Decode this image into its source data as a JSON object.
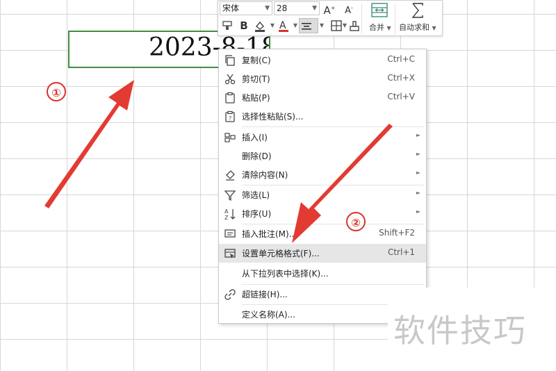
{
  "sheet": {
    "cell_value": "2023-8-18"
  },
  "toolbar": {
    "font_name": "宋体",
    "font_size": "28",
    "merge_label": "合并",
    "autosum_label": "自动求和",
    "underline_color": "#d9322b"
  },
  "menu": {
    "items": [
      {
        "label": "复制(C)",
        "shortcut": "Ctrl+C",
        "icon": "copy-icon"
      },
      {
        "label": "剪切(T)",
        "shortcut": "Ctrl+X",
        "icon": "cut-icon"
      },
      {
        "label": "粘贴(P)",
        "shortcut": "Ctrl+V",
        "icon": "paste-icon"
      },
      {
        "label": "选择性粘贴(S)...",
        "shortcut": "",
        "icon": "paste-special-icon"
      },
      {
        "label": "插入(I)",
        "shortcut": "",
        "icon": "insert-icon"
      },
      {
        "label": "删除(D)",
        "shortcut": "",
        "icon": ""
      },
      {
        "label": "清除内容(N)",
        "shortcut": "",
        "icon": "clear-icon"
      },
      {
        "label": "筛选(L)",
        "shortcut": "",
        "icon": "filter-icon"
      },
      {
        "label": "排序(U)",
        "shortcut": "",
        "icon": "sort-icon"
      },
      {
        "label": "插入批注(M)...",
        "shortcut": "Shift+F2",
        "icon": "comment-icon"
      },
      {
        "label": "设置单元格格式(F)...",
        "shortcut": "Ctrl+1",
        "icon": "format-cells-icon"
      },
      {
        "label": "从下拉列表中选择(K)...",
        "shortcut": "",
        "icon": ""
      },
      {
        "label": "超链接(H)...",
        "shortcut": "",
        "icon": "hyperlink-icon"
      },
      {
        "label": "定义名称(A)...",
        "shortcut": "",
        "icon": ""
      }
    ]
  },
  "annotations": {
    "step1": "①",
    "step2": "②",
    "arrow_color": "#e23b33"
  },
  "watermark": "软件技巧"
}
